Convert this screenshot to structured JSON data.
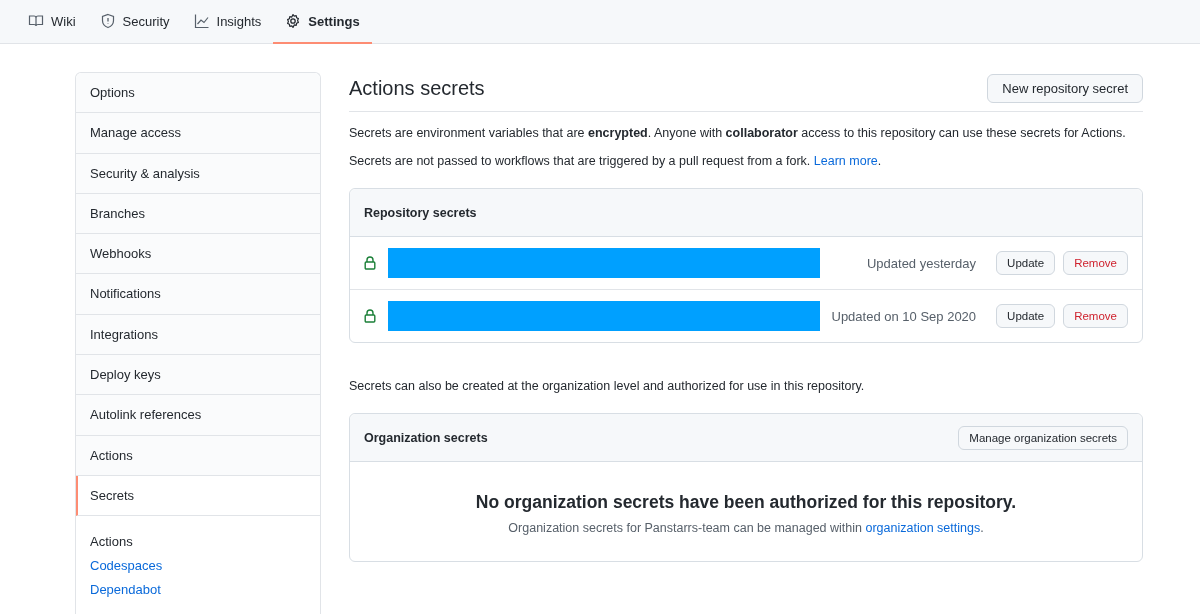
{
  "tabs": [
    {
      "label": "Wiki",
      "kind": "book",
      "selected": false
    },
    {
      "label": "Security",
      "kind": "shield",
      "selected": false
    },
    {
      "label": "Insights",
      "kind": "graph",
      "selected": false
    },
    {
      "label": "Settings",
      "kind": "gear",
      "selected": true
    }
  ],
  "sidebar": {
    "items": [
      {
        "label": "Options",
        "selected": false
      },
      {
        "label": "Manage access",
        "selected": false
      },
      {
        "label": "Security & analysis",
        "selected": false
      },
      {
        "label": "Branches",
        "selected": false
      },
      {
        "label": "Webhooks",
        "selected": false
      },
      {
        "label": "Notifications",
        "selected": false
      },
      {
        "label": "Integrations",
        "selected": false
      },
      {
        "label": "Deploy keys",
        "selected": false
      },
      {
        "label": "Autolink references",
        "selected": false
      },
      {
        "label": "Actions",
        "selected": false
      },
      {
        "label": "Secrets",
        "selected": true
      }
    ],
    "section_heading": "Actions",
    "links": [
      "Codespaces",
      "Dependabot"
    ]
  },
  "main": {
    "title": "Actions secrets",
    "new_button": "New repository secret",
    "intro": [
      "Secrets are environment variables that are **encrypted**. Anyone with **collaborator** access to this repository can use these secrets for Actions.",
      "Secrets are not passed to workflows that are triggered by a pull request from a fork."
    ],
    "learn_more": "Learn more",
    "learn_more_after": ".",
    "repository_secrets": {
      "title": "Repository secrets",
      "rows": [
        {
          "updated": "Updated yesterday",
          "update_button": "Update",
          "remove_button": "Remove"
        },
        {
          "updated": "Updated on 10 Sep 2020",
          "update_button": "Update",
          "remove_button": "Remove"
        }
      ]
    },
    "org_note": "Secrets can also be created at the organization level and authorized for use in this repository.",
    "organization_secrets": {
      "title": "Organization secrets",
      "manage_button": "Manage organization secrets",
      "empty_title": "No organization secrets have been authorized for this repository.",
      "empty_text": "Organization secrets for Panstarrs-team can be managed within",
      "empty_link": "organization settings",
      "empty_after": "."
    }
  }
}
